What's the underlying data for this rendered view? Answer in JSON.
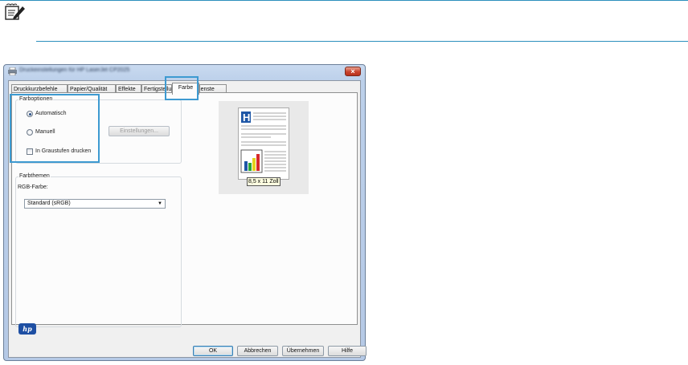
{
  "dialog": {
    "title": "Druckeinstellungen für HP LaserJet CP2025",
    "close_label": "×"
  },
  "tabs": [
    {
      "label": "Druckkurzbefehle"
    },
    {
      "label": "Papier/Qualität"
    },
    {
      "label": "Effekte"
    },
    {
      "label": "Fertigstellung"
    },
    {
      "label": "Farbe"
    },
    {
      "label": "Dienste"
    }
  ],
  "color_options": {
    "title": "Farboptionen",
    "automatic": "Automatisch",
    "manual": "Manuell",
    "settings_button": "Einstellungen...",
    "grayscale": "In Graustufen drucken",
    "selected": "Automatisch"
  },
  "color_themes": {
    "title": "Farbthemen",
    "rgb_label": "RGB-Farbe:",
    "rgb_value": "Standard (sRGB)"
  },
  "preview": {
    "size_label": "8,5 x 11 Zoll"
  },
  "buttons": {
    "ok": "OK",
    "cancel": "Abbrechen",
    "apply": "Übernehmen",
    "help": "Hilfe"
  },
  "logo": {
    "text": "hp"
  }
}
